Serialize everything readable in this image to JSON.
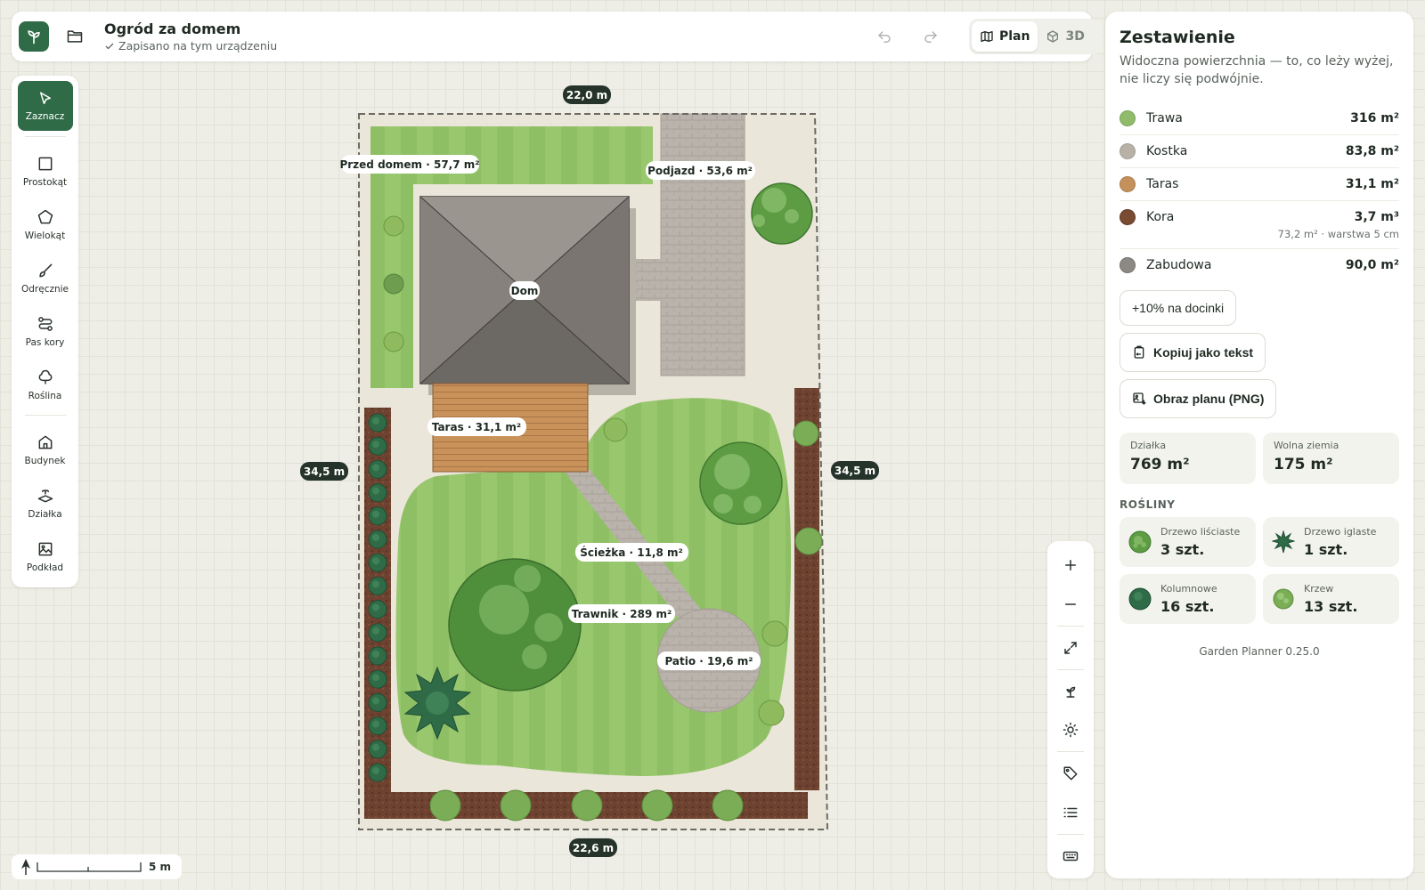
{
  "app": {
    "document_title": "Ogród za domem",
    "save_status": "Zapisano na tym urządzeniu",
    "views": [
      {
        "label": "Plan",
        "icon": "map-icon",
        "active": true
      },
      {
        "label": "3D",
        "icon": "cube-icon",
        "active": false
      }
    ]
  },
  "toolbar": {
    "tools": [
      {
        "label": "Zaznacz",
        "icon": "cursor-icon",
        "active": true
      },
      {
        "label": "Prostokąt",
        "icon": "rectangle-icon"
      },
      {
        "label": "Wielokąt",
        "icon": "pentagon-icon"
      },
      {
        "label": "Odręcznie",
        "icon": "brush-icon"
      },
      {
        "label": "Pas kory",
        "icon": "path-icon"
      },
      {
        "label": "Roślina",
        "icon": "tree-icon"
      },
      {
        "label": "Budynek",
        "icon": "house-icon"
      },
      {
        "label": "Działka",
        "icon": "parcel-icon"
      },
      {
        "label": "Podkład",
        "icon": "image-icon"
      }
    ]
  },
  "rail": {
    "icons": [
      "zoom-in-icon",
      "zoom-out-icon",
      "fit-icon",
      "plant-icon",
      "sun-icon",
      "tag-icon",
      "list-icon",
      "keyboard-icon"
    ]
  },
  "canvas": {
    "dims": {
      "top": "22,0 m",
      "bottom": "22,6 m",
      "left": "34,5 m",
      "right": "34,5 m"
    },
    "labels": {
      "front": "Przed domem · 57,7 m²",
      "driveway": "Podjazd · 53,6 m²",
      "house": "Dom",
      "terrace": "Taras · 31,1 m²",
      "path": "Ścieżka · 11,8 m²",
      "lawn": "Trawnik · 289 m²",
      "patio": "Patio · 19,6 m²"
    },
    "scale_label": "5 m"
  },
  "panel": {
    "title": "Zestawienie",
    "subtitle": "Widoczna powierzchnia — to, co leży wyżej, nie liczy się podwójnie.",
    "materials": [
      {
        "name": "Trawa",
        "area": "316 m²",
        "color": "#8fbb6a",
        "note": ""
      },
      {
        "name": "Kostka",
        "area": "83,8 m²",
        "color": "#b7b1a8",
        "note": ""
      },
      {
        "name": "Taras",
        "area": "31,1 m²",
        "color": "#c4915c",
        "note": ""
      },
      {
        "name": "Kora",
        "area": "3,7 m³",
        "color": "#7a4b33",
        "note": "73,2 m² · warstwa 5 cm"
      },
      {
        "name": "Zabudowa",
        "area": "90,0 m²",
        "color": "#8c8985",
        "note": ""
      }
    ],
    "waste_button": "+10% na docinki",
    "copy_button": "Kopiuj jako tekst",
    "image_button": "Obraz planu (PNG)",
    "stats": [
      {
        "label": "Działka",
        "value": "769 m²"
      },
      {
        "label": "Wolna ziemia",
        "value": "175 m²"
      }
    ],
    "plants_heading": "ROŚLINY",
    "plants": [
      {
        "name": "Drzewo liściaste",
        "count": "3 szt.",
        "icon": "deciduous-tree-icon"
      },
      {
        "name": "Drzewo iglaste",
        "count": "1 szt.",
        "icon": "conifer-icon"
      },
      {
        "name": "Kolumnowe",
        "count": "16 szt.",
        "icon": "columnar-icon"
      },
      {
        "name": "Krzew",
        "count": "13 szt.",
        "icon": "shrub-icon"
      }
    ],
    "version": "Garden Planner 0.25.0"
  },
  "colors": {
    "accent": "#2f6b47",
    "grass": "#8fbb6a",
    "paving": "#b7b1a8",
    "terrace": "#c4915c",
    "bark": "#7a4b33",
    "roof": "#7f7a75"
  }
}
